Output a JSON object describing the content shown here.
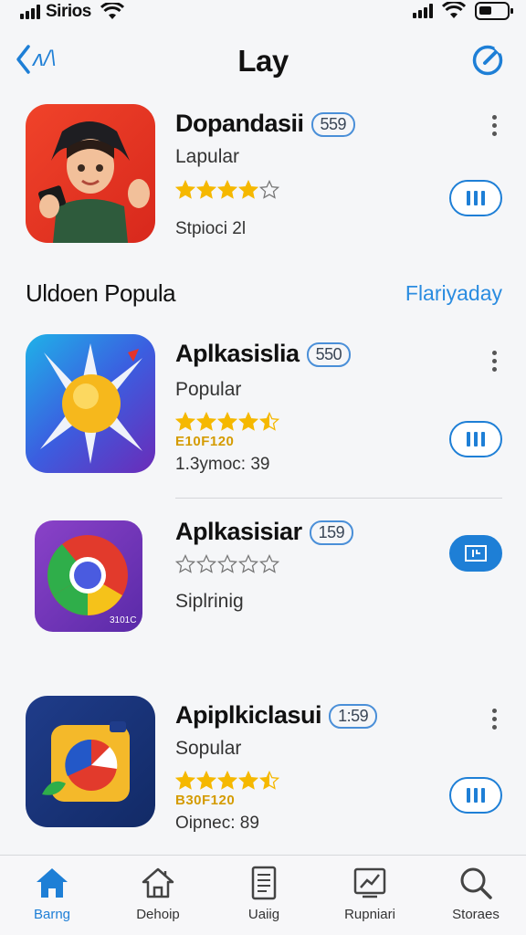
{
  "status_bar": {
    "carrier": "Sirios"
  },
  "nav": {
    "back_label": "ʌ/\\",
    "title": "Lay"
  },
  "apps": [
    {
      "name": "Dopandasii",
      "badge": "559",
      "subtitle": "Lapular",
      "rating": 4,
      "rank": "",
      "meta": "Stpioci 2l"
    },
    {
      "name": "Aplkasislia",
      "badge": "550",
      "subtitle": "Popular",
      "rating": 4.5,
      "rank": "E10F120",
      "meta": "1.3ymoc: 39"
    },
    {
      "name": "Aplkasisiar",
      "badge": "159",
      "subtitle": "",
      "rating": 0,
      "rank": "",
      "meta": "Siplrinig",
      "icon_text": "3101C"
    },
    {
      "name": "Apiplkiclasui",
      "badge": "1:59",
      "subtitle": "Sopular",
      "rating": 4.5,
      "rank": "B30F120",
      "meta": "Oipnec: 89"
    }
  ],
  "section": {
    "title": "Uldoen Popula",
    "link": "Flariyaday"
  },
  "tabs": [
    {
      "label": "Barng",
      "icon": "home-icon",
      "active": true
    },
    {
      "label": "Dehoip",
      "icon": "house-outline-icon",
      "active": false
    },
    {
      "label": "Uaiig",
      "icon": "document-icon",
      "active": false
    },
    {
      "label": "Rupniari",
      "icon": "chart-icon",
      "active": false
    },
    {
      "label": "Storaes",
      "icon": "search-icon",
      "active": false
    }
  ],
  "colors": {
    "accent": "#1e7fd6",
    "star": "#f5b800",
    "background": "#f5f6f8"
  }
}
